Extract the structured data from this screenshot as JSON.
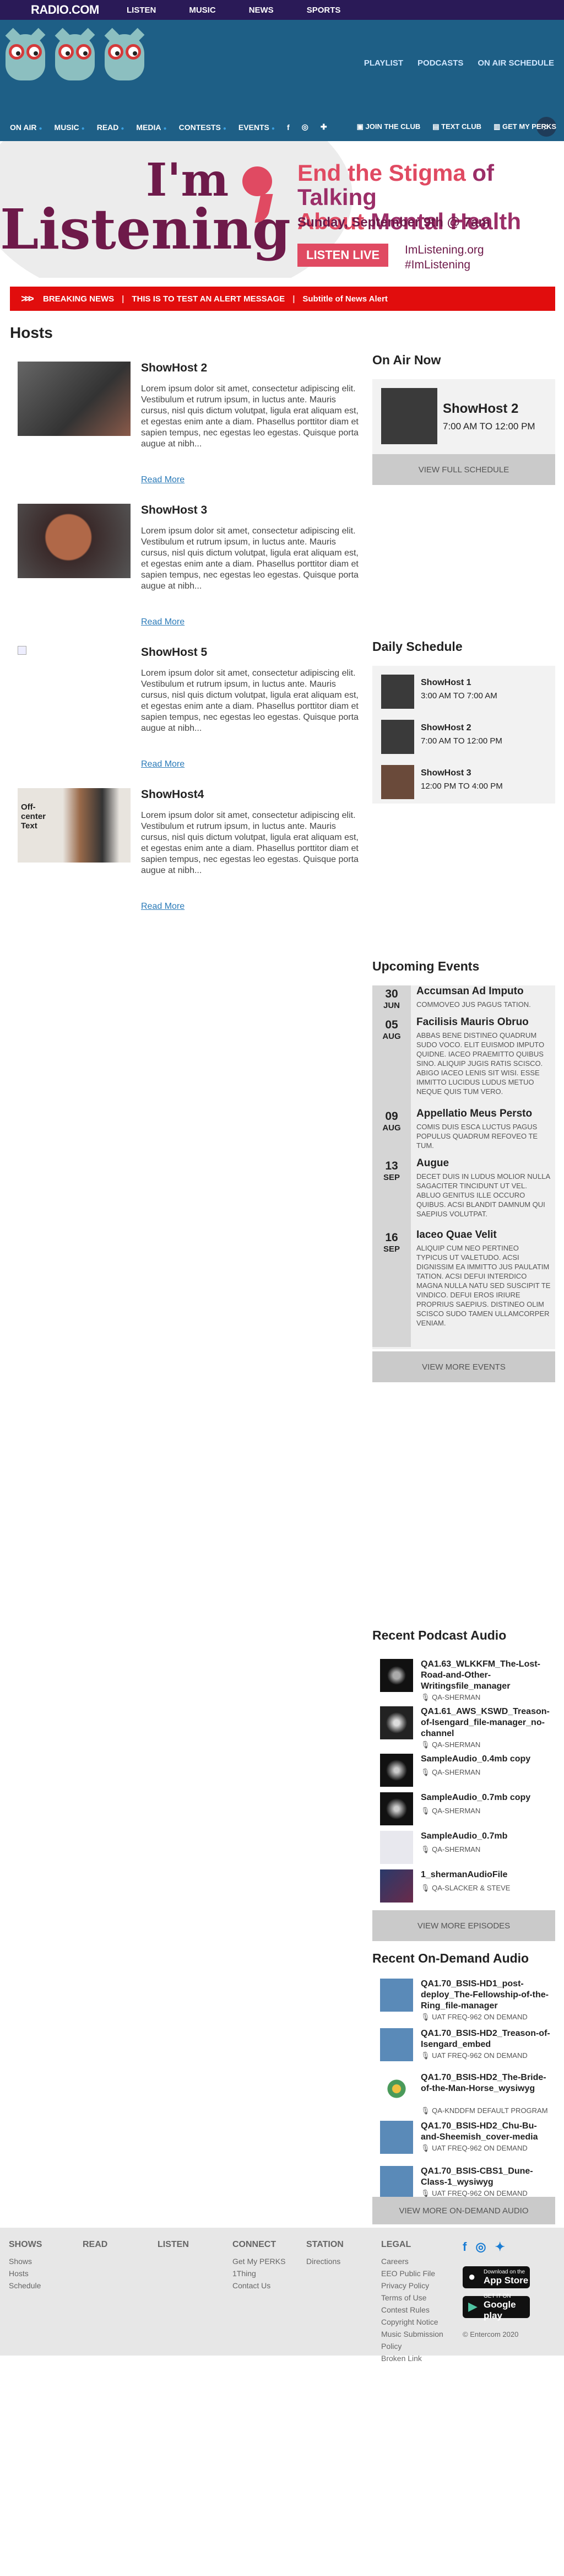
{
  "site": {
    "logo": "RADIO.COM",
    "topnav": [
      "LISTEN",
      "MUSIC",
      "NEWS",
      "SPORTS"
    ],
    "header_links": [
      "PLAYLIST",
      "PODCASTS",
      "ON AIR SCHEDULE"
    ],
    "mainnav": [
      "ON AIR",
      "MUSIC",
      "READ",
      "MEDIA",
      "CONTESTS",
      "EVENTS"
    ],
    "actions": [
      "JOIN THE CLUB",
      "TEXT CLUB",
      "GET MY PERKS"
    ]
  },
  "banner": {
    "line1": "I'm",
    "line2": "Listening",
    "headline_a": "End the Stigma",
    "headline_b": "of Talking",
    "headline_c": "About",
    "headline_d": "Mental Health",
    "date": "Sunday, September 9th @ 7am",
    "button": "LISTEN LIVE",
    "url": "ImListening.org",
    "hashtag": "#ImListening"
  },
  "alert": {
    "label": "BREAKING NEWS",
    "message": "THIS IS TO TEST AN ALERT MESSAGE",
    "subtitle": "Subtitle of News Alert"
  },
  "page_title": "Hosts",
  "hosts": [
    {
      "name": "ShowHost 2",
      "desc": "Lorem ipsum dolor sit amet, consectetur adipiscing elit. Vestibulum et rutrum ipsum, in luctus ante. Mauris cursus, nisl quis dictum volutpat, ligula erat aliquam est, et egestas enim ante a diam. Phasellus porttitor diam et sapien tempus, nec egestas leo egestas. Quisque porta augue at nibh...",
      "more": "Read More"
    },
    {
      "name": "ShowHost 3",
      "desc": "Lorem ipsum dolor sit amet, consectetur adipiscing elit. Vestibulum et rutrum ipsum, in luctus ante. Mauris cursus, nisl quis dictum volutpat, ligula erat aliquam est, et egestas enim ante a diam. Phasellus porttitor diam et sapien tempus, nec egestas leo egestas. Quisque porta augue at nibh...",
      "more": "Read More"
    },
    {
      "name": "ShowHost 5",
      "desc": "Lorem ipsum dolor sit amet, consectetur adipiscing elit. Vestibulum et rutrum ipsum, in luctus ante. Mauris cursus, nisl quis dictum volutpat, ligula erat aliquam est, et egestas enim ante a diam. Phasellus porttitor diam et sapien tempus, nec egestas leo egestas. Quisque porta augue at nibh...",
      "more": "Read More"
    },
    {
      "name": "ShowHost4",
      "desc": "Lorem ipsum dolor sit amet, consectetur adipiscing elit. Vestibulum et rutrum ipsum, in luctus ante. Mauris cursus, nisl quis dictum volutpat, ligula erat aliquam est, et egestas enim ante a diam. Phasellus porttitor diam et sapien tempus, nec egestas leo egestas. Quisque porta augue at nibh...",
      "more": "Read More",
      "img_text": "Off-center Text"
    }
  ],
  "on_air": {
    "heading": "On Air Now",
    "name": "ShowHost 2",
    "time": "7:00 AM TO 12:00 PM",
    "button": "VIEW FULL SCHEDULE"
  },
  "daily": {
    "heading": "Daily Schedule",
    "items": [
      {
        "name": "ShowHost 1",
        "time": "3:00 AM TO 7:00 AM"
      },
      {
        "name": "ShowHost 2",
        "time": "7:00 AM TO 12:00 PM"
      },
      {
        "name": "ShowHost 3",
        "time": "12:00 PM TO 4:00 PM"
      }
    ]
  },
  "events": {
    "heading": "Upcoming Events",
    "items": [
      {
        "day": "30",
        "month": "JUN",
        "title": "Accumsan Ad Imputo",
        "desc": "COMMOVEO JUS PAGUS TATION."
      },
      {
        "day": "05",
        "month": "AUG",
        "title": "Facilisis Mauris Obruo",
        "desc": "ABBAS BENE DISTINEO QUADRUM SUDO VOCO. ELIT EUISMOD IMPUTO QUIDNE. IACEO PRAEMITTO QUIBUS SINO. ALIQUIP JUGIS RATIS SCISCO. ABIGO IACEO LENIS SIT WISI. ESSE IMMITTO LUCIDUS LUDUS METUO NEQUE QUIS TUM VERO."
      },
      {
        "day": "09",
        "month": "AUG",
        "title": "Appellatio Meus Persto",
        "desc": "COMIS DUIS ESCA LUCTUS PAGUS POPULUS QUADRUM REFOVEO TE TUM."
      },
      {
        "day": "13",
        "month": "SEP",
        "title": "Augue",
        "desc": "DECET DUIS IN LUDUS MOLIOR NULLA SAGACITER TINCIDUNT UT VEL. ABLUO GENITUS ILLE OCCURO QUIBUS. ACSI BLANDIT DAMNUM QUI SAEPIUS VOLUTPAT."
      },
      {
        "day": "16",
        "month": "SEP",
        "title": "Iaceo Quae Velit",
        "desc": "ALIQUIP CUM NEO PERTINEO TYPICUS UT VALETUDO. ACSI DIGNISSIM EA IMMITTO JUS PAULATIM TATION. ACSI DEFUI INTERDICO MAGNA NULLA NATU SED SUSCIPIT TE VINDICO. DEFUI EROS IRIURE PROPRIUS SAEPIUS. DISTINEO OLIM SCISCO SUDO TAMEN ULLAMCORPER VENIAM."
      }
    ],
    "button": "VIEW MORE EVENTS"
  },
  "podcasts": {
    "heading": "Recent Podcast Audio",
    "items": [
      {
        "name": "QA1.63_WLKKFM_The-Lost-Road-and-Other-Writingsfile_manager",
        "author": "QA-SHERMAN"
      },
      {
        "name": "QA1.61_AWS_KSWD_Treason-of-Isengard_file-manager_no-channel",
        "author": "QA-SHERMAN"
      },
      {
        "name": "SampleAudio_0.4mb copy",
        "author": "QA-SHERMAN"
      },
      {
        "name": "SampleAudio_0.7mb copy",
        "author": "QA-SHERMAN"
      },
      {
        "name": "SampleAudio_0.7mb",
        "author": "QA-SHERMAN"
      },
      {
        "name": "1_shermanAudioFile",
        "author": "QA-SLACKER & STEVE"
      }
    ],
    "button": "VIEW MORE EPISODES"
  },
  "ondemand": {
    "heading": "Recent On-Demand Audio",
    "items": [
      {
        "name": "QA1.70_BSIS-HD1_post-deploy_The-Fellowship-of-the-Ring_file-manager",
        "author": "UAT FREQ-962 ON DEMAND"
      },
      {
        "name": "QA1.70_BSIS-HD2_Treason-of-Isengard_embed",
        "author": "UAT FREQ-962 ON DEMAND"
      },
      {
        "name": "QA1.70_BSIS-HD2_The-Bride-of-the-Man-Horse_wysiwyg",
        "author": "QA-KNDDFM DEFAULT PROGRAM"
      },
      {
        "name": "QA1.70_BSIS-HD2_Chu-Bu-and-Sheemish_cover-media",
        "author": "UAT FREQ-962 ON DEMAND"
      },
      {
        "name": "QA1.70_BSIS-CBS1_Dune-Class-1_wysiwyg",
        "author": "UAT FREQ-962 ON DEMAND"
      }
    ],
    "button": "VIEW MORE ON-DEMAND AUDIO"
  },
  "footer": {
    "shows": {
      "heading": "SHOWS",
      "links": [
        "Shows",
        "Hosts",
        "Schedule"
      ]
    },
    "read": {
      "heading": "READ",
      "links": []
    },
    "listen": {
      "heading": "LISTEN",
      "links": []
    },
    "connect": {
      "heading": "CONNECT",
      "links": [
        "Get My PERKS",
        "1Thing",
        "Contact Us"
      ]
    },
    "station": {
      "heading": "STATION",
      "links": [
        "Directions"
      ]
    },
    "legal": {
      "heading": "LEGAL",
      "links": [
        "Careers",
        "EEO Public File",
        "Privacy Policy",
        "Terms of Use",
        "Contest Rules",
        "Copyright Notice",
        "Music Submission Policy",
        "Broken Link"
      ]
    },
    "appstore": {
      "line1": "Download on the",
      "line2": "App Store"
    },
    "googleplay": {
      "line1": "GET IT ON",
      "line2": "Google play"
    },
    "copyright": "© Entercom 2020"
  }
}
